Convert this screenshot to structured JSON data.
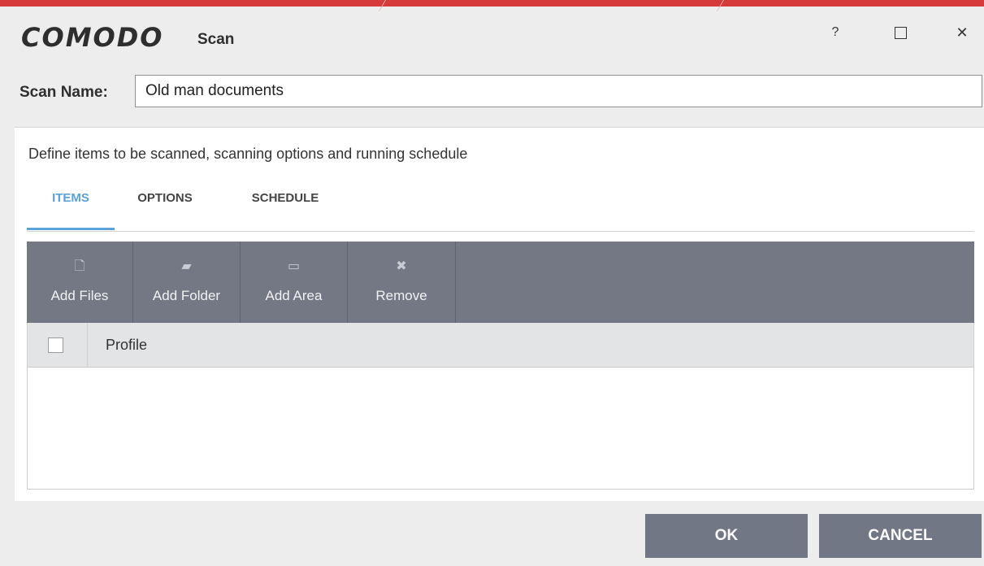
{
  "app": {
    "brand": "COMODO",
    "window_title": "Scan"
  },
  "window_controls": {
    "help": "?",
    "close": "✕"
  },
  "scan_name": {
    "label": "Scan Name:",
    "value": "Old man documents"
  },
  "panel": {
    "description": "Define items to be scanned, scanning options and running schedule",
    "tabs": [
      {
        "label": "ITEMS",
        "active": true
      },
      {
        "label": "OPTIONS",
        "active": false
      },
      {
        "label": "SCHEDULE",
        "active": false
      }
    ],
    "toolbar": [
      {
        "icon": "add-file-icon",
        "glyph": "🗋",
        "label": "Add Files"
      },
      {
        "icon": "add-folder-icon",
        "glyph": "▰",
        "label": "Add Folder"
      },
      {
        "icon": "add-area-icon",
        "glyph": "▭",
        "label": "Add Area"
      },
      {
        "icon": "remove-icon",
        "glyph": "✖",
        "label": "Remove"
      }
    ],
    "table": {
      "columns": [
        "Profile"
      ],
      "rows": []
    }
  },
  "footer": {
    "ok_label": "OK",
    "cancel_label": "CANCEL"
  },
  "colors": {
    "brand_red": "#d63a3a",
    "accent_blue": "#5ba2d8",
    "toolbar_gray": "#737884"
  }
}
